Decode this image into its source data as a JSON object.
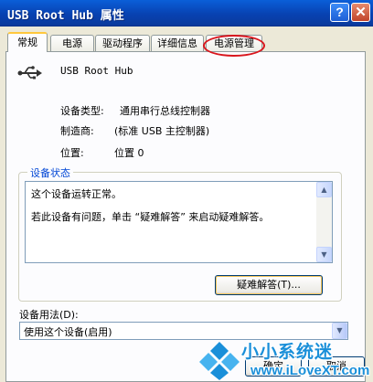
{
  "window": {
    "title": "USB Root Hub 属性",
    "help_label": "?",
    "close_label": "✕"
  },
  "tabs": [
    {
      "label": "常规",
      "active": true
    },
    {
      "label": "电源",
      "active": false
    },
    {
      "label": "驱动程序",
      "active": false
    },
    {
      "label": "详细信息",
      "active": false
    },
    {
      "label": "电源管理",
      "active": false,
      "highlighted": true
    }
  ],
  "device": {
    "icon": "usb-icon",
    "name": "USB Root Hub",
    "properties": [
      {
        "label": "设备类型:",
        "value": "通用串行总线控制器"
      },
      {
        "label": "制造商:",
        "value": "(标准 USB 主控制器)"
      },
      {
        "label": "位置:",
        "value": "位置 0"
      }
    ]
  },
  "status": {
    "group_label": "设备状态",
    "line1": "这个设备运转正常。",
    "line2": "若此设备有问题，单击 “疑难解答” 来启动疑难解答。",
    "troubleshoot_label": "疑难解答(T)..."
  },
  "usage": {
    "label": "设备用法(D):",
    "selected": "使用这个设备(启用)"
  },
  "buttons": {
    "ok_label": "确定",
    "cancel_label": "取消"
  },
  "watermark": {
    "title": "小小系统迷",
    "url": "www.iLoveXT.com"
  },
  "colors": {
    "titlebar": "#0842b2",
    "group_label": "#0046d5",
    "annotation": "#d9161d",
    "watermark": "#1a8fd9"
  }
}
